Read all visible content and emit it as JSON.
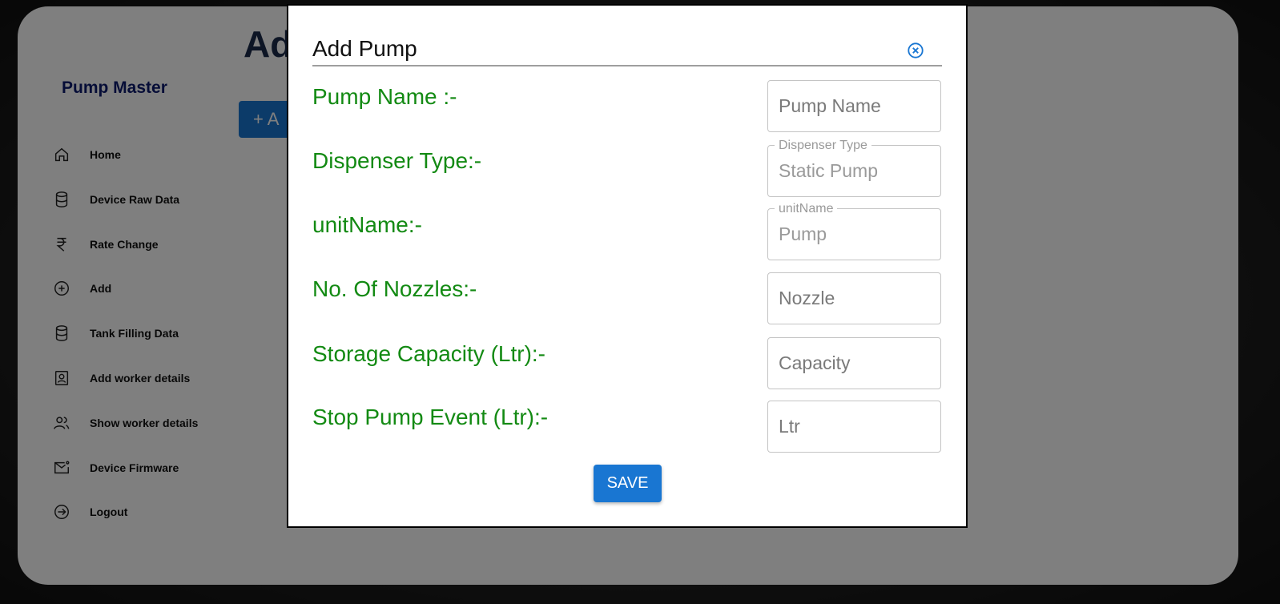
{
  "sidebar": {
    "brand": "Pump Master",
    "items": [
      {
        "label": "Home",
        "icon": "home-icon"
      },
      {
        "label": "Device Raw Data",
        "icon": "database-icon"
      },
      {
        "label": "Rate Change",
        "icon": "rupee-icon"
      },
      {
        "label": "Add",
        "icon": "plus-circle-icon"
      },
      {
        "label": "Tank Filling Data",
        "icon": "database-icon"
      },
      {
        "label": "Add worker details",
        "icon": "contact-card-icon"
      },
      {
        "label": "Show worker details",
        "icon": "users-icon"
      },
      {
        "label": "Device Firmware",
        "icon": "mail-icon"
      },
      {
        "label": "Logout",
        "icon": "logout-icon"
      }
    ]
  },
  "page": {
    "heading_partial": "Ad",
    "add_button_partial": "+ A"
  },
  "modal": {
    "title": "Add Pump",
    "fields": {
      "pump_name": {
        "label": "Pump Name :-",
        "placeholder": "Pump Name"
      },
      "dispenser_type": {
        "label": "Dispenser Type:-",
        "legend": "Dispenser Type",
        "value": "Static Pump"
      },
      "unit_name": {
        "label": "unitName:-",
        "legend": "unitName",
        "value": "Pump"
      },
      "nozzles": {
        "label": "No. Of Nozzles:-",
        "placeholder": "Nozzle"
      },
      "capacity": {
        "label": "Storage Capacity (Ltr):-",
        "placeholder": "Capacity"
      },
      "stop_event": {
        "label": "Stop Pump Event (Ltr):-",
        "placeholder": "Ltr"
      }
    },
    "save_label": "SAVE"
  },
  "colors": {
    "label_green": "#138a13",
    "primary_blue": "#1976d2",
    "brand_navy": "#0d1b6e"
  }
}
